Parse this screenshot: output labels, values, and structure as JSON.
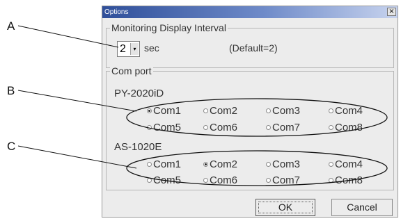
{
  "callouts": {
    "a": "A",
    "b": "B",
    "c": "C"
  },
  "dialog": {
    "title": "Options",
    "close_glyph": "×",
    "monitoring": {
      "legend": "Monitoring Display Interval",
      "interval_value": "2",
      "dropdown_arrow": "▾",
      "unit": "sec",
      "default_note": "(Default=2)"
    },
    "com_port": {
      "legend": "Com port",
      "devices": [
        {
          "name": "PY-2020iD",
          "options": [
            "Com1",
            "Com2",
            "Com3",
            "Com4",
            "Com5",
            "Com6",
            "Com7",
            "Com8"
          ],
          "selected": "Com1"
        },
        {
          "name": "AS-1020E",
          "options": [
            "Com1",
            "Com2",
            "Com3",
            "Com4",
            "Com5",
            "Com6",
            "Com7",
            "Com8"
          ],
          "selected": "Com2"
        }
      ]
    },
    "buttons": {
      "ok": "OK",
      "cancel": "Cancel"
    }
  },
  "colors": {
    "titlebar_start": "#2f4f9a",
    "titlebar_end": "#c7d3ee",
    "dialog_bg": "#ececec"
  }
}
